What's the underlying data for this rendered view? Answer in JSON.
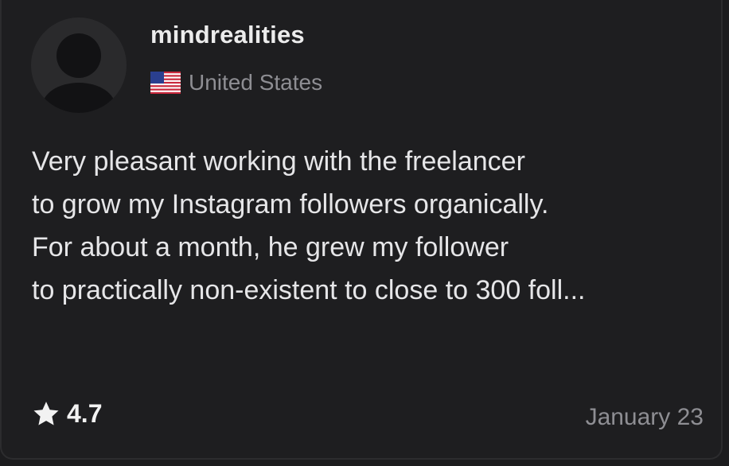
{
  "review_card": {
    "username": "mindrealities",
    "country": {
      "flag_icon": "us-flag-icon",
      "name": "United States"
    },
    "review_lines": [
      "Very pleasant working with the freelancer",
      "to grow my Instagram followers organically.",
      "For about a month, he grew my follower",
      "to practically non-existent to close to 300 foll..."
    ],
    "rating": {
      "icon": "star-icon",
      "value": "4.7"
    },
    "date": "January 23"
  },
  "colors": {
    "background": "#1e1e20",
    "avatar_bg": "#2a2a2c",
    "avatar_fg": "#121214",
    "text_primary": "#e6e6e8",
    "text_secondary": "#8e8e93"
  }
}
